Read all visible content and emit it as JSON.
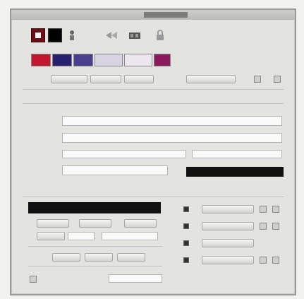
{
  "window": {
    "title": "",
    "accent_colors": {
      "titlebar_dark": "#7c7c78",
      "panel_bg": "#e3e3e0"
    }
  },
  "toolbar": {
    "icons": [
      "stop-icon",
      "black-square-icon",
      "person-icon",
      "rewind-icon",
      "film-icon",
      "lock-icon"
    ]
  },
  "palette": {
    "swatches": [
      "#c2172e",
      "#27206d",
      "#4a3f8f",
      "#d8d4e3",
      "#ece6ef",
      "#8b1a5c"
    ]
  },
  "form": {
    "row_labels": [
      "",
      "",
      "",
      "",
      ""
    ],
    "text_fields": [
      "",
      "",
      ""
    ],
    "buttons": [
      "",
      "",
      "",
      ""
    ]
  },
  "lower_panel": {
    "readout": "",
    "left_buttons": [
      "",
      "",
      "",
      ""
    ],
    "right_buttons": [
      "",
      "",
      "",
      ""
    ]
  }
}
